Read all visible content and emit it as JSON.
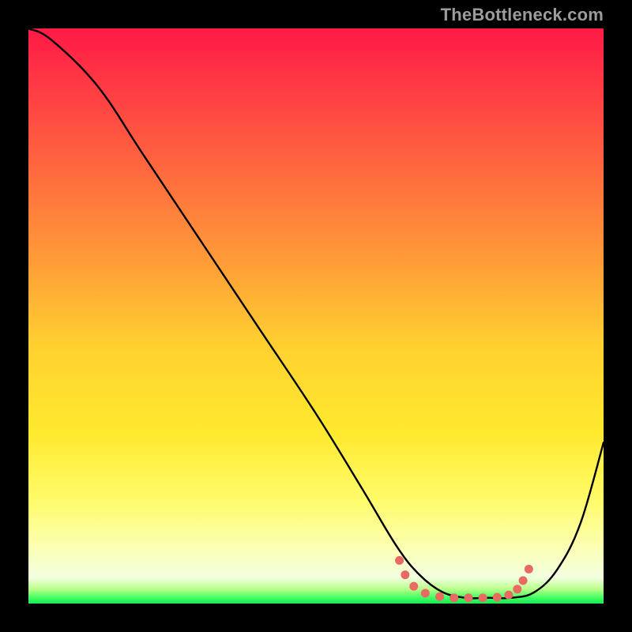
{
  "watermark": "TheBottleneck.com",
  "gradient": {
    "stops": [
      {
        "offset": 0.0,
        "color": "#ff1a46"
      },
      {
        "offset": 0.1,
        "color": "#ff3a44"
      },
      {
        "offset": 0.25,
        "color": "#ff6a3e"
      },
      {
        "offset": 0.4,
        "color": "#ff9a38"
      },
      {
        "offset": 0.55,
        "color": "#ffd030"
      },
      {
        "offset": 0.7,
        "color": "#ffe92d"
      },
      {
        "offset": 0.82,
        "color": "#fffb6a"
      },
      {
        "offset": 0.9,
        "color": "#fcffb0"
      },
      {
        "offset": 0.955,
        "color": "#f2ffe0"
      },
      {
        "offset": 0.975,
        "color": "#b8ff88"
      },
      {
        "offset": 0.99,
        "color": "#40ff62"
      },
      {
        "offset": 1.0,
        "color": "#18e656"
      }
    ]
  },
  "chart_data": {
    "type": "line",
    "title": "",
    "xlabel": "",
    "ylabel": "",
    "xlim": [
      0,
      100
    ],
    "ylim": [
      0,
      100
    ],
    "grid": false,
    "series": [
      {
        "name": "curve",
        "x": [
          0,
          4,
          12,
          20,
          30,
          40,
          50,
          58,
          64,
          68,
          72,
          76,
          80,
          84,
          88,
          92,
          96,
          100
        ],
        "values": [
          100,
          98,
          90,
          78,
          63,
          48,
          33,
          20,
          10,
          5,
          2,
          1,
          1,
          1,
          2,
          6,
          14,
          28
        ]
      }
    ],
    "markers": {
      "name": "fit-range",
      "color": "#e86a63",
      "points": [
        {
          "x": 64.5,
          "y": 7.5
        },
        {
          "x": 65.5,
          "y": 5.0
        },
        {
          "x": 67.0,
          "y": 3.0
        },
        {
          "x": 69.0,
          "y": 1.8
        },
        {
          "x": 71.5,
          "y": 1.2
        },
        {
          "x": 74.0,
          "y": 1.0
        },
        {
          "x": 76.5,
          "y": 1.0
        },
        {
          "x": 79.0,
          "y": 1.0
        },
        {
          "x": 81.5,
          "y": 1.1
        },
        {
          "x": 83.5,
          "y": 1.5
        },
        {
          "x": 85.0,
          "y": 2.5
        },
        {
          "x": 86.0,
          "y": 4.0
        },
        {
          "x": 87.0,
          "y": 6.0
        }
      ]
    }
  }
}
